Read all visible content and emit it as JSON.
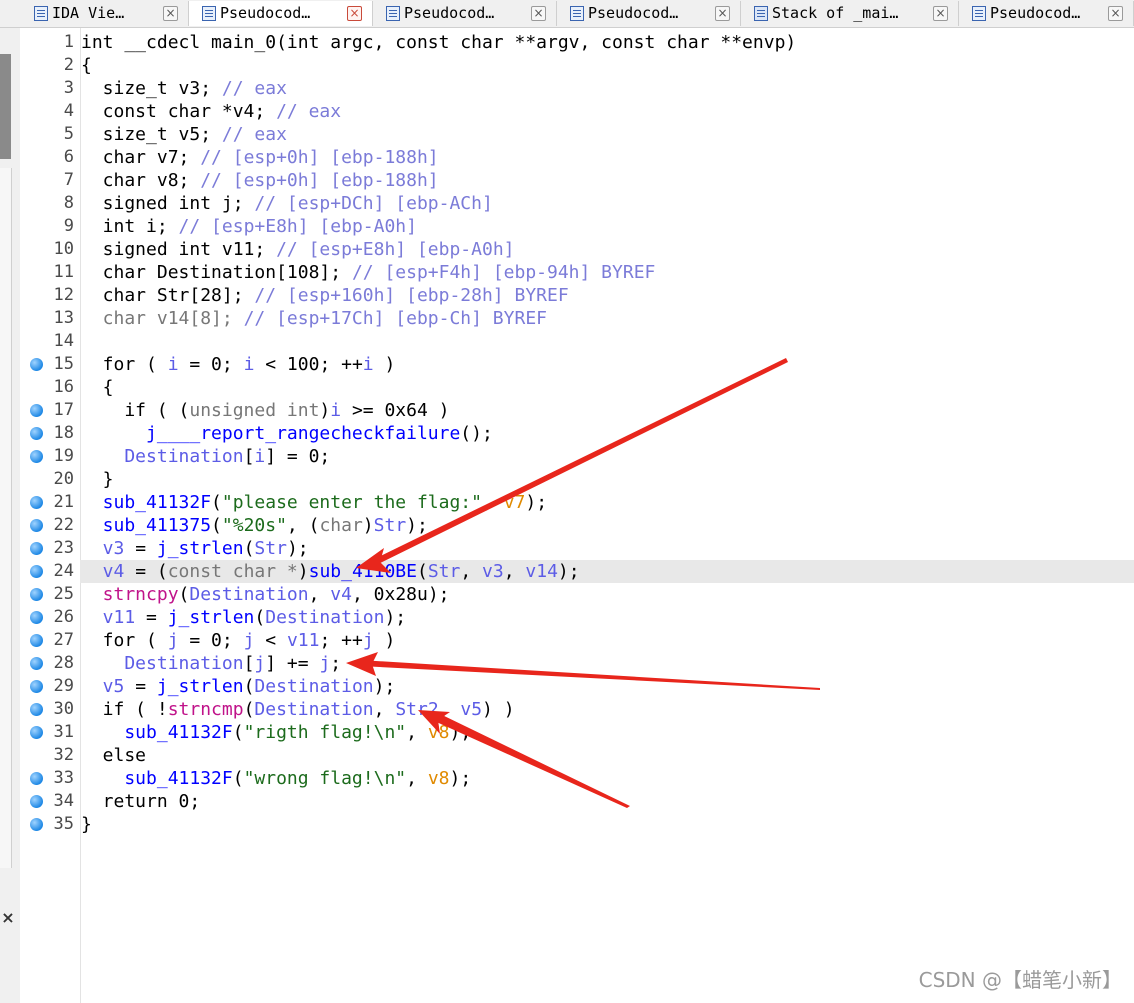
{
  "tabs": [
    {
      "label": "IDA Vie…",
      "icon": "ida-view-icon",
      "active": false
    },
    {
      "label": "Pseudocod…",
      "icon": "pseudocode-icon",
      "active": true
    },
    {
      "label": "Pseudocod…",
      "icon": "pseudocode-icon",
      "active": false
    },
    {
      "label": "Pseudocod…",
      "icon": "pseudocode-icon",
      "active": false
    },
    {
      "label": "Stack of _mai…",
      "icon": "stack-icon",
      "active": false
    },
    {
      "label": "Pseudocod…",
      "icon": "pseudocode-icon",
      "active": false
    }
  ],
  "close_glyph": "×",
  "code": {
    "lines": [
      {
        "n": "1",
        "bp": false,
        "tokens": [
          [
            "k",
            "int __cdecl main_0(int argc, const char **argv, const char **envp)"
          ]
        ]
      },
      {
        "n": "2",
        "bp": false,
        "tokens": [
          [
            "k",
            "{"
          ]
        ]
      },
      {
        "n": "3",
        "bp": false,
        "tokens": [
          [
            "k",
            "  size_t v3; "
          ],
          [
            "c",
            "// eax"
          ]
        ]
      },
      {
        "n": "4",
        "bp": false,
        "tokens": [
          [
            "k",
            "  const char *v4; "
          ],
          [
            "c",
            "// eax"
          ]
        ]
      },
      {
        "n": "5",
        "bp": false,
        "tokens": [
          [
            "k",
            "  size_t v5; "
          ],
          [
            "c",
            "// eax"
          ]
        ]
      },
      {
        "n": "6",
        "bp": false,
        "tokens": [
          [
            "k",
            "  char v7; "
          ],
          [
            "c",
            "// [esp+0h] [ebp-188h]"
          ]
        ]
      },
      {
        "n": "7",
        "bp": false,
        "tokens": [
          [
            "k",
            "  char v8; "
          ],
          [
            "c",
            "// [esp+0h] [ebp-188h]"
          ]
        ]
      },
      {
        "n": "8",
        "bp": false,
        "tokens": [
          [
            "k",
            "  signed int j; "
          ],
          [
            "c",
            "// [esp+DCh] [ebp-ACh]"
          ]
        ]
      },
      {
        "n": "9",
        "bp": false,
        "tokens": [
          [
            "k",
            "  int i; "
          ],
          [
            "c",
            "// [esp+E8h] [ebp-A0h]"
          ]
        ]
      },
      {
        "n": "10",
        "bp": false,
        "tokens": [
          [
            "k",
            "  signed int v11; "
          ],
          [
            "c",
            "// [esp+E8h] [ebp-A0h]"
          ]
        ]
      },
      {
        "n": "11",
        "bp": false,
        "tokens": [
          [
            "k",
            "  char Destination[108]; "
          ],
          [
            "c",
            "// [esp+F4h] [ebp-94h] BYREF"
          ]
        ]
      },
      {
        "n": "12",
        "bp": false,
        "tokens": [
          [
            "k",
            "  char Str[28]; "
          ],
          [
            "c",
            "// [esp+160h] [ebp-28h] BYREF"
          ]
        ]
      },
      {
        "n": "13",
        "bp": false,
        "tokens": [
          [
            "g",
            "  char v14[8]; "
          ],
          [
            "c",
            "// [esp+17Ch] [ebp-Ch] BYREF"
          ]
        ]
      },
      {
        "n": "14",
        "bp": false,
        "tokens": [
          [
            "k",
            ""
          ]
        ]
      },
      {
        "n": "15",
        "bp": true,
        "tokens": [
          [
            "k",
            "  for ( "
          ],
          [
            "v",
            "i"
          ],
          [
            "k",
            " = 0; "
          ],
          [
            "v",
            "i"
          ],
          [
            "k",
            " < 100; ++"
          ],
          [
            "v",
            "i"
          ],
          [
            "k",
            " )"
          ]
        ]
      },
      {
        "n": "16",
        "bp": false,
        "tokens": [
          [
            "k",
            "  {"
          ]
        ]
      },
      {
        "n": "17",
        "bp": true,
        "tokens": [
          [
            "k",
            "    if ( ("
          ],
          [
            "g",
            "unsigned int"
          ],
          [
            "k",
            ")"
          ],
          [
            "v",
            "i"
          ],
          [
            "k",
            " >= 0x64 )"
          ]
        ]
      },
      {
        "n": "18",
        "bp": true,
        "tokens": [
          [
            "f",
            "      j____report_rangecheckfailure"
          ],
          [
            "k",
            "();"
          ]
        ]
      },
      {
        "n": "19",
        "bp": true,
        "tokens": [
          [
            "v",
            "    Destination"
          ],
          [
            "k",
            "["
          ],
          [
            "v",
            "i"
          ],
          [
            "k",
            "] = 0;"
          ]
        ]
      },
      {
        "n": "20",
        "bp": false,
        "tokens": [
          [
            "k",
            "  }"
          ]
        ]
      },
      {
        "n": "21",
        "bp": true,
        "tokens": [
          [
            "f",
            "  sub_41132F"
          ],
          [
            "k",
            "("
          ],
          [
            "s",
            "\"please enter the flag:\""
          ],
          [
            "k",
            ", "
          ],
          [
            "o",
            "v7"
          ],
          [
            "k",
            ");"
          ]
        ]
      },
      {
        "n": "22",
        "bp": true,
        "tokens": [
          [
            "f",
            "  sub_411375"
          ],
          [
            "k",
            "("
          ],
          [
            "s",
            "\"%20s\""
          ],
          [
            "k",
            ", ("
          ],
          [
            "g",
            "char"
          ],
          [
            "k",
            ")"
          ],
          [
            "v",
            "Str"
          ],
          [
            "k",
            ");"
          ]
        ]
      },
      {
        "n": "23",
        "bp": true,
        "tokens": [
          [
            "v",
            "  v3"
          ],
          [
            "k",
            " = "
          ],
          [
            "f",
            "j_strlen"
          ],
          [
            "k",
            "("
          ],
          [
            "v",
            "Str"
          ],
          [
            "k",
            ");"
          ]
        ]
      },
      {
        "n": "24",
        "bp": true,
        "hl": true,
        "tokens": [
          [
            "v",
            "  v4"
          ],
          [
            "k",
            " = ("
          ],
          [
            "g",
            "const char *"
          ],
          [
            "k",
            ")"
          ],
          [
            "f",
            "sub_4110BE"
          ],
          [
            "k",
            "("
          ],
          [
            "v",
            "Str"
          ],
          [
            "k",
            ", "
          ],
          [
            "v",
            "v3"
          ],
          [
            "k",
            ", "
          ],
          [
            "v",
            "v14"
          ],
          [
            "k",
            ");"
          ]
        ]
      },
      {
        "n": "25",
        "bp": true,
        "tokens": [
          [
            "r",
            "  strncpy"
          ],
          [
            "k",
            "("
          ],
          [
            "v",
            "Destination"
          ],
          [
            "k",
            ", "
          ],
          [
            "v",
            "v4"
          ],
          [
            "k",
            ", 0x28u);"
          ]
        ]
      },
      {
        "n": "26",
        "bp": true,
        "tokens": [
          [
            "v",
            "  v11"
          ],
          [
            "k",
            " = "
          ],
          [
            "f",
            "j_strlen"
          ],
          [
            "k",
            "("
          ],
          [
            "v",
            "Destination"
          ],
          [
            "k",
            ");"
          ]
        ]
      },
      {
        "n": "27",
        "bp": true,
        "tokens": [
          [
            "k",
            "  for ( "
          ],
          [
            "v",
            "j"
          ],
          [
            "k",
            " = 0; "
          ],
          [
            "v",
            "j"
          ],
          [
            "k",
            " < "
          ],
          [
            "v",
            "v11"
          ],
          [
            "k",
            "; ++"
          ],
          [
            "v",
            "j"
          ],
          [
            "k",
            " )"
          ]
        ]
      },
      {
        "n": "28",
        "bp": true,
        "tokens": [
          [
            "v",
            "    Destination"
          ],
          [
            "k",
            "["
          ],
          [
            "v",
            "j"
          ],
          [
            "k",
            "] += "
          ],
          [
            "v",
            "j"
          ],
          [
            "k",
            ";"
          ]
        ]
      },
      {
        "n": "29",
        "bp": true,
        "tokens": [
          [
            "v",
            "  v5"
          ],
          [
            "k",
            " = "
          ],
          [
            "f",
            "j_strlen"
          ],
          [
            "k",
            "("
          ],
          [
            "v",
            "Destination"
          ],
          [
            "k",
            ");"
          ]
        ]
      },
      {
        "n": "30",
        "bp": true,
        "tokens": [
          [
            "k",
            "  if ( !"
          ],
          [
            "r",
            "strncmp"
          ],
          [
            "k",
            "("
          ],
          [
            "v",
            "Destination"
          ],
          [
            "k",
            ", "
          ],
          [
            "v",
            "Str2"
          ],
          [
            "k",
            ", "
          ],
          [
            "v",
            "v5"
          ],
          [
            "k",
            ") )"
          ]
        ]
      },
      {
        "n": "31",
        "bp": true,
        "tokens": [
          [
            "f",
            "    sub_41132F"
          ],
          [
            "k",
            "("
          ],
          [
            "s",
            "\"rigth flag!\\n\""
          ],
          [
            "k",
            ", "
          ],
          [
            "o",
            "v8"
          ],
          [
            "k",
            ");"
          ]
        ]
      },
      {
        "n": "32",
        "bp": false,
        "tokens": [
          [
            "k",
            "  else"
          ]
        ]
      },
      {
        "n": "33",
        "bp": true,
        "tokens": [
          [
            "f",
            "    sub_41132F"
          ],
          [
            "k",
            "("
          ],
          [
            "s",
            "\"wrong flag!\\n\""
          ],
          [
            "k",
            ", "
          ],
          [
            "o",
            "v8"
          ],
          [
            "k",
            ");"
          ]
        ]
      },
      {
        "n": "34",
        "bp": true,
        "tokens": [
          [
            "k",
            "  return 0;"
          ]
        ]
      },
      {
        "n": "35",
        "bp": true,
        "tokens": [
          [
            "k",
            "}"
          ]
        ]
      }
    ]
  },
  "watermark": "CSDN @【蜡笔小新】"
}
